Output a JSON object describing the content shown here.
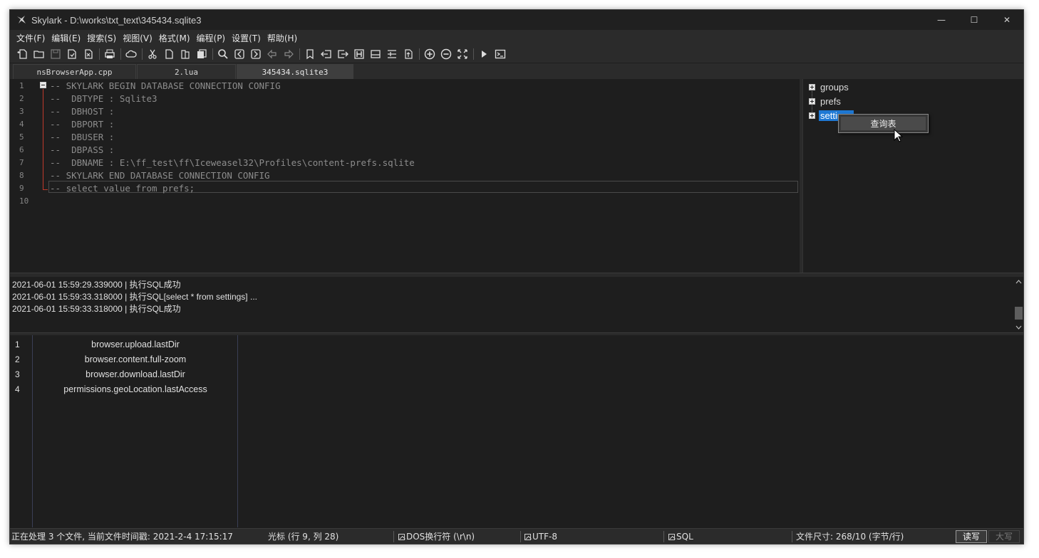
{
  "window": {
    "title": "Skylark - D:\\works\\txt_text\\345434.sqlite3",
    "minimize_glyph": "—",
    "maximize_glyph": "☐",
    "close_glyph": "✕"
  },
  "menu": [
    "文件(F)",
    "编辑(E)",
    "搜索(S)",
    "视图(V)",
    "格式(M)",
    "编程(P)",
    "设置(T)",
    "帮助(H)"
  ],
  "toolbar": {
    "icons": [
      "new-file-icon",
      "open-folder-icon",
      "save-icon",
      "save-all-icon",
      "close-file-icon",
      "print-icon",
      "cloud-icon",
      "cut-icon",
      "copy-icon",
      "paste-icon",
      "clipboard-icon",
      "search-icon",
      "prev-icon",
      "next-icon",
      "undo-icon",
      "redo-icon",
      "bookmark-icon",
      "indent-left-icon",
      "indent-right-icon",
      "hex-icon",
      "print-preview-icon",
      "wrap-icon",
      "upload-icon",
      "zoom-in-icon",
      "zoom-out-icon",
      "fullscreen-icon",
      "run-icon",
      "console-icon"
    ]
  },
  "tabs": [
    {
      "label": "nsBrowserApp.cpp",
      "active": false
    },
    {
      "label": "2.lua",
      "active": false
    },
    {
      "label": "345434.sqlite3",
      "active": true
    }
  ],
  "editor": {
    "lines": [
      {
        "num": "1",
        "text": "-- SKYLARK BEGIN DATABASE CONNECTION CONFIG"
      },
      {
        "num": "2",
        "text": "--  DBTYPE : Sqlite3"
      },
      {
        "num": "3",
        "text": "--  DBHOST :"
      },
      {
        "num": "4",
        "text": "--  DBPORT :"
      },
      {
        "num": "5",
        "text": "--  DBUSER :"
      },
      {
        "num": "6",
        "text": "--  DBPASS :"
      },
      {
        "num": "7",
        "text": "--  DBNAME : E:\\ff_test\\ff\\Iceweasel32\\Profiles\\content-prefs.sqlite"
      },
      {
        "num": "8",
        "text": "-- SKYLARK END DATABASE CONNECTION CONFIG"
      },
      {
        "num": "9",
        "text": "-- select value from prefs;"
      },
      {
        "num": "10",
        "text": ""
      }
    ],
    "current_line": "9"
  },
  "tree": {
    "items": [
      {
        "label": "groups",
        "selected": false
      },
      {
        "label": "prefs",
        "selected": false
      },
      {
        "label": "settings",
        "selected": true
      }
    ],
    "context_menu": {
      "item": "查询表"
    }
  },
  "log": {
    "lines": [
      "2021-06-01 15:59:29.339000 | 执行SQL成功",
      "2021-06-01 15:59:33.318000 | 执行SQL[select * from settings] ...",
      "2021-06-01 15:59:33.318000 | 执行SQL成功"
    ]
  },
  "results": {
    "rows": [
      {
        "num": "1",
        "value": "browser.upload.lastDir"
      },
      {
        "num": "2",
        "value": "browser.content.full-zoom"
      },
      {
        "num": "3",
        "value": "browser.download.lastDir"
      },
      {
        "num": "4",
        "value": "permissions.geoLocation.lastAccess"
      }
    ]
  },
  "status": {
    "processing": "正在处理 3 个文件, 当前文件时间戳: 2021-2-4 17:15:17",
    "cursor": "光标 (行 9, 列 28)",
    "eol": "DOS换行符 (\\r\\n)",
    "encoding": "UTF-8",
    "language": "SQL",
    "filesize": "文件尺寸: 268/10 (字节/行)",
    "readwrite": "读写",
    "caps": "大写"
  }
}
